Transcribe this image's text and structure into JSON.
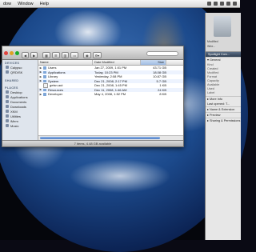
{
  "menubar": {
    "items": [
      "dow",
      "Window",
      "Help"
    ]
  },
  "finder": {
    "search_placeholder": "",
    "sidebar": {
      "devices_header": "DEVICES",
      "devices": [
        "Calypso",
        "QRDISK"
      ],
      "shared_header": "SHARED",
      "places_header": "PLACES",
      "places": [
        "Desktop",
        "Applications",
        "Documents",
        "Downloads",
        "XKM",
        "Utilities",
        "iMem",
        "Music"
      ]
    },
    "columns": {
      "name": "Name",
      "date": "Date Modified",
      "size": "Size"
    },
    "rows": [
      {
        "name": "Users",
        "date": "Jan 27, 2009, 1:01 PM",
        "size": "43.71 GB"
      },
      {
        "name": "Applications",
        "date": "Today, 10:23 PM",
        "size": "18.08 GB"
      },
      {
        "name": "Library",
        "date": "Yesterday, 2:08 PM",
        "size": "10.87 GB"
      },
      {
        "name": "System",
        "date": "Dec 21, 2008, 2:17 PM",
        "size": "5.7 GB"
      },
      {
        "name": "getsn.aut",
        "date": "Dec 21, 2008, 1:45 PM",
        "size": "1 KB"
      },
      {
        "name": "Resources",
        "date": "Dec 11, 2008, 1:46 AM",
        "size": "24 KB"
      },
      {
        "name": "Developer",
        "date": "May 4, 2008, 1:52 PM",
        "size": "8 KB"
      }
    ],
    "status": "7 items, 4.48 GB available"
  },
  "info_panel": {
    "caption1": "Modified",
    "caption2": "Wire...",
    "bar_title": "Spotlight Com...",
    "general_header": "General",
    "fields": [
      {
        "label": "Kind",
        "value": ""
      },
      {
        "label": "Created",
        "value": ""
      },
      {
        "label": "Modified",
        "value": ""
      },
      {
        "label": "Format",
        "value": ""
      },
      {
        "label": "Capacity",
        "value": ""
      },
      {
        "label": "Available",
        "value": ""
      },
      {
        "label": "Used",
        "value": ""
      },
      {
        "label": "Label",
        "value": ""
      }
    ],
    "sections": [
      "More Info",
      "Name & Extension",
      "Preview",
      "Sharing & Permissions"
    ],
    "last_opened": "Last opened: T..."
  },
  "colors": {
    "close": "#e0443e",
    "minimize": "#dea123",
    "zoom": "#1aab29",
    "selection": "#9fbde4"
  }
}
